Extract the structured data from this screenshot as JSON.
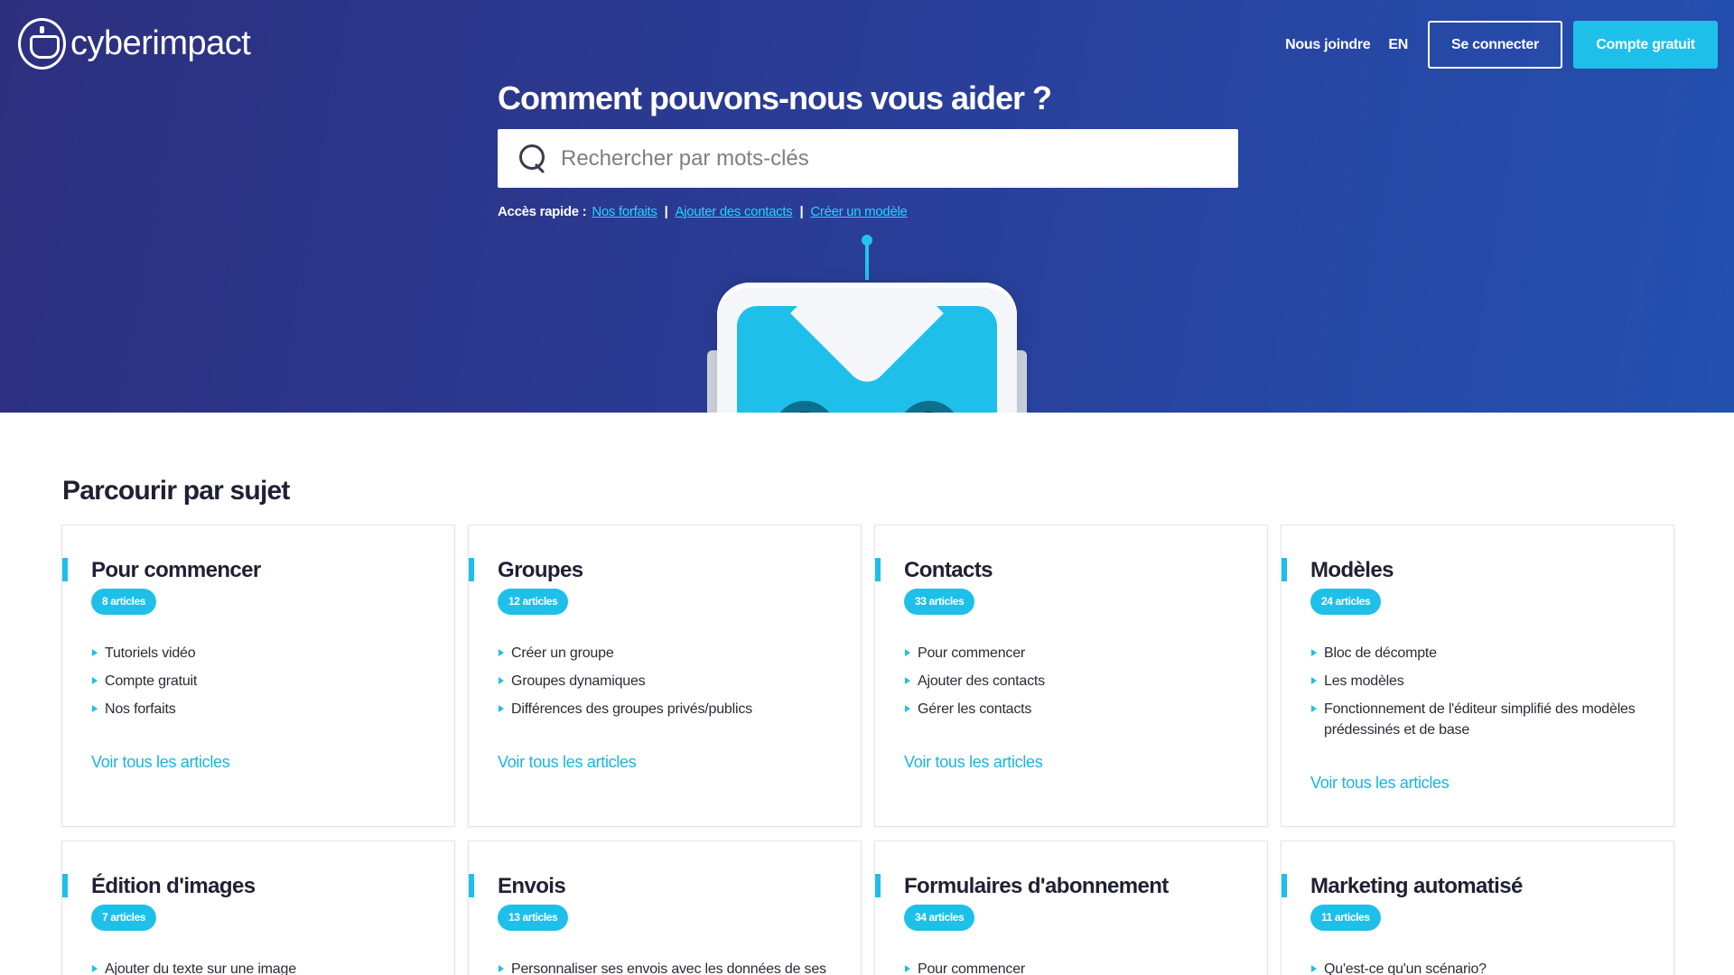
{
  "brand": {
    "name": "cyberimpact"
  },
  "nav": {
    "join": "Nous joindre",
    "lang": "EN",
    "login": "Se connecter",
    "signup": "Compte gratuit"
  },
  "hero": {
    "headline": "Comment pouvons-nous vous aider ?",
    "search_placeholder": "Rechercher par mots-clés",
    "quick_label": "Accès rapide :",
    "quick_links": [
      "Nos forfaits",
      "Ajouter des contacts",
      "Créer un modèle"
    ],
    "separator": "|"
  },
  "section": {
    "title": "Parcourir par sujet"
  },
  "cards": [
    {
      "title": "Pour commencer",
      "count": "8 articles",
      "items": [
        "Tutoriels vidéo",
        "Compte gratuit",
        "Nos forfaits"
      ],
      "see_all": "Voir tous les articles"
    },
    {
      "title": "Groupes",
      "count": "12 articles",
      "items": [
        "Créer un groupe",
        "Groupes dynamiques",
        "Différences des groupes privés/publics"
      ],
      "see_all": "Voir tous les articles"
    },
    {
      "title": "Contacts",
      "count": "33 articles",
      "items": [
        "Pour commencer",
        "Ajouter des contacts",
        "Gérer les contacts"
      ],
      "see_all": "Voir tous les articles"
    },
    {
      "title": "Modèles",
      "count": "24 articles",
      "items": [
        "Bloc de décompte",
        "Les modèles",
        "Fonctionnement de l'éditeur simplifié des modèles prédessinés et de base"
      ],
      "see_all": "Voir tous les articles"
    },
    {
      "title": "Édition d'images",
      "count": "7 articles",
      "items": [
        "Ajouter du texte sur une image"
      ],
      "see_all": ""
    },
    {
      "title": "Envois",
      "count": "13 articles",
      "items": [
        "Personnaliser ses envois avec les données de ses"
      ],
      "see_all": ""
    },
    {
      "title": "Formulaires d'abonnement",
      "count": "34 articles",
      "items": [
        "Pour commencer"
      ],
      "see_all": ""
    },
    {
      "title": "Marketing automatisé",
      "count": "11 articles",
      "items": [
        "Qu'est-ce qu'un scénario?"
      ],
      "see_all": ""
    }
  ],
  "colors": {
    "accent": "#1ec0ea",
    "hero_start": "#2d2f7e",
    "hero_end": "#2450b0"
  }
}
